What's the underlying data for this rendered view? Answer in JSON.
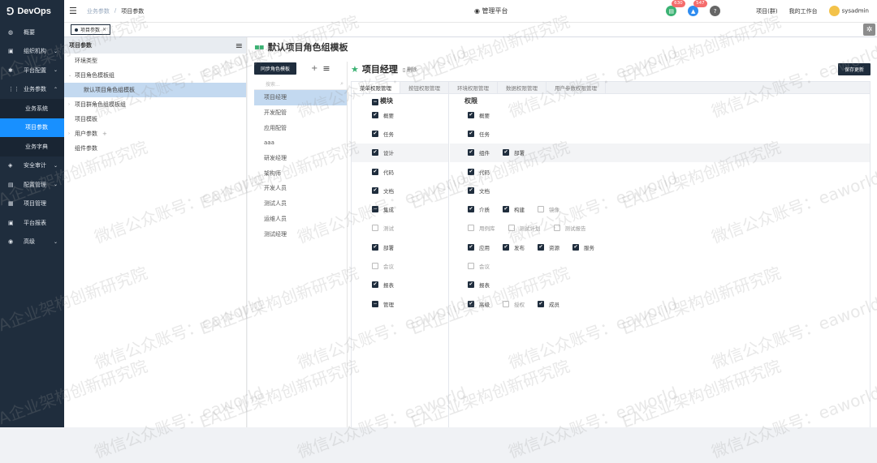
{
  "app": {
    "title": "DevOps"
  },
  "sidebar": [
    {
      "type": "item",
      "icon": "dashboard-icon",
      "glyph": "◍",
      "label": "概要"
    },
    {
      "type": "item",
      "icon": "lock-icon",
      "glyph": "▣",
      "label": "组织机构",
      "chev": "⌄"
    },
    {
      "type": "item",
      "icon": "gear-icon",
      "glyph": "✱",
      "label": "平台配置",
      "chev": "⌄"
    },
    {
      "type": "item",
      "icon": "params-icon",
      "glyph": "⋮⋮",
      "label": "业务参数",
      "chev": "⌃"
    },
    {
      "type": "sub",
      "label": "业务系统"
    },
    {
      "type": "sub",
      "label": "项目参数",
      "active": true
    },
    {
      "type": "sub",
      "label": "业务字典"
    },
    {
      "type": "item",
      "icon": "shield-icon",
      "glyph": "◈",
      "label": "安全审计",
      "chev": "⌄"
    },
    {
      "type": "item",
      "icon": "config-icon",
      "glyph": "▤",
      "label": "配置管理",
      "chev": "⌄"
    },
    {
      "type": "item",
      "icon": "project-icon",
      "glyph": "▦",
      "label": "项目管理"
    },
    {
      "type": "item",
      "icon": "report-icon",
      "glyph": "▣",
      "label": "平台报表"
    },
    {
      "type": "item",
      "icon": "advanced-icon",
      "glyph": "◉",
      "label": "高级",
      "chev": "⌄"
    }
  ],
  "header": {
    "breadcrumb": [
      "业务参数",
      "/",
      "项目参数"
    ],
    "platform": "管理平台",
    "badge1": "630",
    "badge2": "547",
    "project": "项目(群)",
    "workbench": "我的工作台",
    "user": "sysadmin"
  },
  "tabs": {
    "active": "项目参数",
    "close": "×"
  },
  "params": {
    "title": "项目参数",
    "menu": "≡",
    "tree": [
      {
        "label": "环境类型",
        "level": 0
      },
      {
        "label": "项目角色模板组",
        "level": 0,
        "arrow": "⌄"
      },
      {
        "label": "默认项目角色组模板",
        "level": 1,
        "selected": true
      },
      {
        "label": "项目群角色组模板组",
        "level": 0,
        "arrow": "›"
      },
      {
        "label": "项目模板",
        "level": 0
      },
      {
        "label": "用户参数",
        "level": 0,
        "arrow": "›",
        "extra": "+"
      },
      {
        "label": "组件参数",
        "level": 0
      }
    ]
  },
  "main": {
    "title": "默认项目角色组模板",
    "sync_button": "同步角色模板",
    "plus": "+",
    "menu": "≡",
    "search_placeholder": "搜索...",
    "roles": [
      "项目经理",
      "开发配管",
      "应用配管",
      "aaa",
      "研发经理",
      "架构师",
      "开发人员",
      "测试人员",
      "运维人员",
      "测试经理"
    ],
    "role_title": "项目经理",
    "delete": "删除",
    "save": "保存更新",
    "perm_tabs": [
      "菜单权限管理",
      "按钮权限管理",
      "环境权限管理",
      "数据权限管理",
      "用户参数权限管理"
    ],
    "module_header": "模块",
    "perm_header": "权限",
    "rows": [
      {
        "module": "概要",
        "mstate": "on",
        "perms": [
          {
            "label": "概要",
            "on": true
          }
        ]
      },
      {
        "module": "任务",
        "mstate": "on",
        "perms": [
          {
            "label": "任务",
            "on": true
          }
        ]
      },
      {
        "module": "设计",
        "mstate": "on",
        "hl": true,
        "perms": [
          {
            "label": "组件",
            "on": true
          },
          {
            "label": "部署",
            "on": true
          }
        ]
      },
      {
        "module": "代码",
        "mstate": "on",
        "perms": [
          {
            "label": "代码",
            "on": true
          }
        ]
      },
      {
        "module": "文档",
        "mstate": "on",
        "perms": [
          {
            "label": "文档",
            "on": true
          }
        ]
      },
      {
        "module": "集成",
        "mstate": "ind",
        "perms": [
          {
            "label": "介质",
            "on": true
          },
          {
            "label": "构建",
            "on": true
          },
          {
            "label": "镜像",
            "on": false
          }
        ]
      },
      {
        "module": "测试",
        "mstate": "off",
        "perms": [
          {
            "label": "用例库",
            "on": false
          },
          {
            "label": "测试计划",
            "on": false
          },
          {
            "label": "测试报告",
            "on": false
          }
        ]
      },
      {
        "module": "部署",
        "mstate": "on",
        "perms": [
          {
            "label": "应用",
            "on": true
          },
          {
            "label": "发布",
            "on": true
          },
          {
            "label": "资源",
            "on": true
          },
          {
            "label": "服务",
            "on": true
          }
        ]
      },
      {
        "module": "会议",
        "mstate": "off",
        "perms": [
          {
            "label": "会议",
            "on": false
          }
        ]
      },
      {
        "module": "报表",
        "mstate": "on",
        "perms": [
          {
            "label": "报表",
            "on": true
          }
        ]
      },
      {
        "module": "管理",
        "mstate": "ind",
        "perms": [
          {
            "label": "高级",
            "on": true
          },
          {
            "label": "授权",
            "on": false
          },
          {
            "label": "成员",
            "on": true
          }
        ]
      }
    ]
  },
  "watermark": [
    "EA企业架构创新研究院",
    "微信公众账号：eaworld"
  ]
}
